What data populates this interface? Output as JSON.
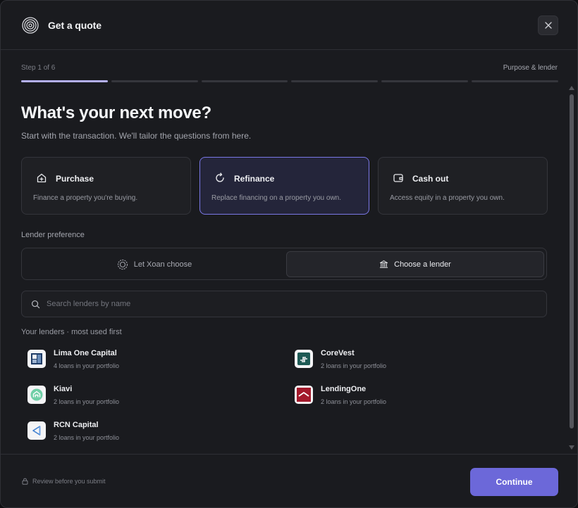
{
  "header": {
    "title": "Get a quote",
    "close_icon": "close-icon",
    "logo_icon": "concentric-rings-logo"
  },
  "stepper": {
    "label": "Step 1 of 6",
    "current_step_name": "Purpose & lender",
    "current": 1,
    "total": 6
  },
  "main": {
    "heading": "What's your next move?",
    "subtitle": "Start with the transaction. We'll tailor the questions from here.",
    "options": [
      {
        "title": "Purchase",
        "description": "Finance a property you're buying.",
        "icon": "house-plus-icon",
        "selected": false
      },
      {
        "title": "Refinance",
        "description": "Replace financing on a property you own.",
        "icon": "refresh-icon",
        "selected": true
      },
      {
        "title": "Cash out",
        "description": "Access equity in a property you own.",
        "icon": "wallet-icon",
        "selected": false
      }
    ],
    "lender_preference": {
      "label": "Lender preference",
      "options": [
        {
          "label": "Let Xoan choose",
          "icon": "sparkle-ring-icon",
          "selected": false
        },
        {
          "label": "Choose a lender",
          "icon": "bank-icon",
          "selected": true
        }
      ]
    },
    "search": {
      "placeholder": "Search lenders by name",
      "value": ""
    },
    "lenders_label": "Your lenders · most used first",
    "lenders": [
      {
        "name": "Lima One Capital",
        "meta": "4 loans in your portfolio"
      },
      {
        "name": "CoreVest",
        "meta": "2 loans in your portfolio"
      },
      {
        "name": "Kiavi",
        "meta": "2 loans in your portfolio"
      },
      {
        "name": "LendingOne",
        "meta": "2 loans in your portfolio"
      },
      {
        "name": "RCN Capital",
        "meta": "2 loans in your portfolio"
      }
    ]
  },
  "footer": {
    "note": "Review before you submit",
    "note_icon": "lock-icon",
    "continue_label": "Continue"
  },
  "colors": {
    "accent": "#6c68d9",
    "selected_border": "#7a78e6",
    "progress_active": "#b4b0f2"
  }
}
